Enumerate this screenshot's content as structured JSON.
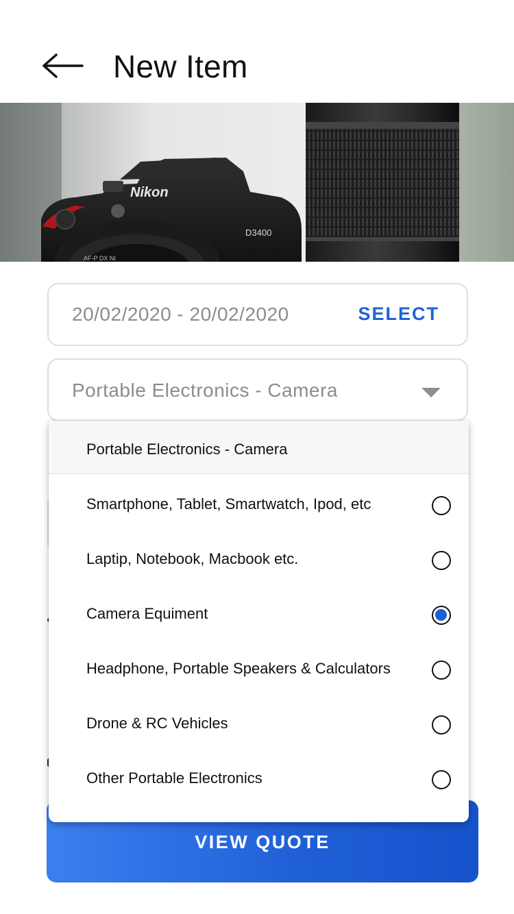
{
  "header": {
    "title": "New Item",
    "back_icon": "arrow-left-icon"
  },
  "hero": {
    "brand_text": "Nikon",
    "model_text": "D3400",
    "lens_text": "AF-P DX NI"
  },
  "date_range": {
    "value": "20/02/2020 - 20/02/2020",
    "select_label": "SELECT",
    "accent_color": "#1f63d6"
  },
  "category": {
    "value": "Portable Electronics - Camera",
    "arrow_icon": "caret-down-icon"
  },
  "dropdown": {
    "header": "Portable Electronics - Camera",
    "options": [
      {
        "label": "Smartphone, Tablet, Smartwatch, Ipod, etc",
        "selected": false
      },
      {
        "label": "Laptip, Notebook, Macbook etc.",
        "selected": false
      },
      {
        "label": "Camera Equiment",
        "selected": true
      },
      {
        "label": "Headphone, Portable Speakers & Calculators",
        "selected": false
      },
      {
        "label": "Drone & RC Vehicles",
        "selected": false
      },
      {
        "label": "Other Portable Electronics",
        "selected": false
      }
    ]
  },
  "actions": {
    "view_quote_label": "VIEW QUOTE",
    "button_color": "#1f5fd6"
  }
}
